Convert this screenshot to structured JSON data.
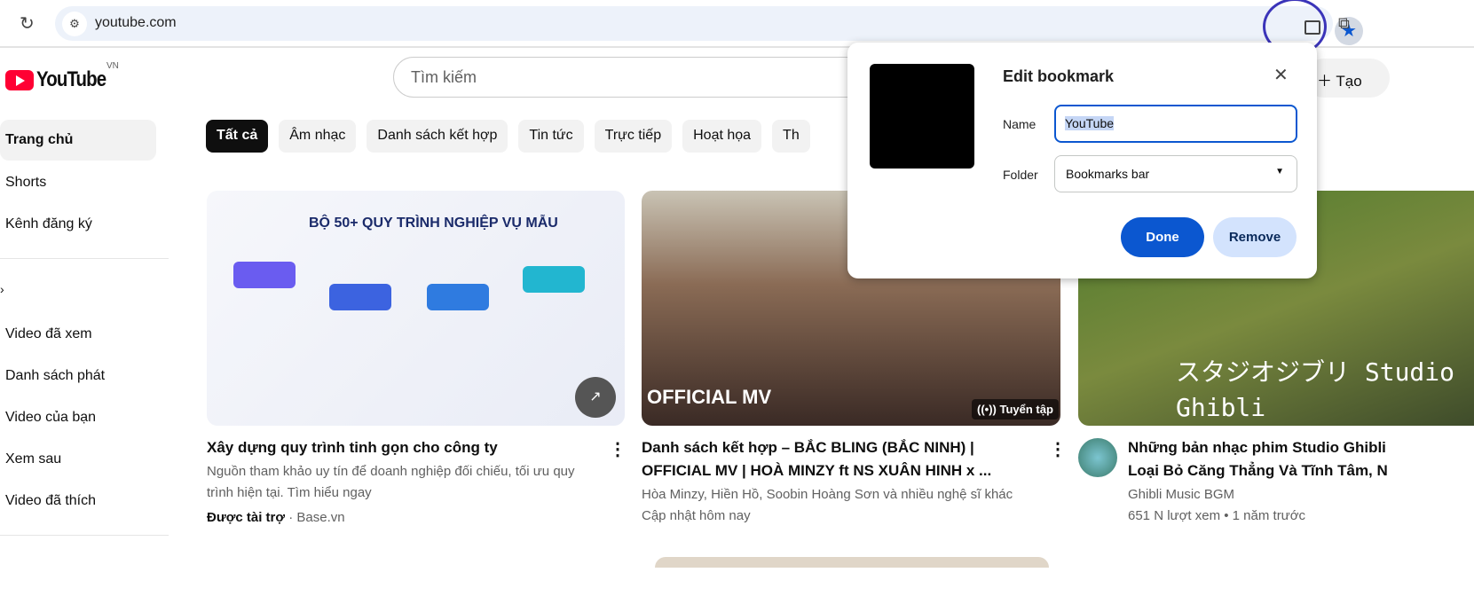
{
  "browser": {
    "url": "youtube.com",
    "icons": [
      "reload-icon",
      "site-settings-icon",
      "cast-icon",
      "bookmark-star-icon",
      "extensions-icon"
    ],
    "accent": "#0b57d0"
  },
  "youtube": {
    "logo": "YouTube",
    "region": "VN",
    "search_placeholder": "Tìm kiếm",
    "create_label": "Tạo",
    "sidebar": [
      {
        "label": "Trang chủ"
      },
      {
        "label": "Shorts"
      },
      {
        "label": "Kênh đăng ký"
      },
      {
        "label": "Video đã xem"
      },
      {
        "label": "Danh sách phát"
      },
      {
        "label": "Video của bạn"
      },
      {
        "label": "Xem sau"
      },
      {
        "label": "Video đã thích"
      }
    ],
    "chips": [
      "Tất cả",
      "Âm nhạc",
      "Danh sách kết hợp",
      "Tin tức",
      "Trực tiếp",
      "Hoạt họa",
      "Th"
    ],
    "videos": [
      {
        "title": "Xây dựng quy trình tinh gọn cho công ty",
        "desc": "Nguồn tham khảo uy tín để doanh nghiệp đối chiếu, tối ưu quy trình hiện tại. Tìm hiểu ngay",
        "sponsored": "Được tài trợ",
        "channel": "Base.vn",
        "thumb_text": "BỘ 50+ QUY TRÌNH NGHIỆP VỤ MẪU"
      },
      {
        "title": "Danh sách kết hợp – BẮC BLING (BẮC NINH) | OFFICIAL MV | HOÀ MINZY ft NS XUÂN HINH x ...",
        "channel": "Hòa Minzy, Hiền Hồ, Soobin Hoàng Sơn và nhiều nghệ sĩ khác",
        "meta": "Cập nhật hôm nay",
        "badge": "Tuyển tập",
        "thumb_text": "OFFICIAL MV"
      },
      {
        "title": "Những bản nhạc phim Studio Ghibli Loại Bỏ Căng Thẳng Và Tĩnh Tâm, N",
        "channel": "Ghibli Music BGM",
        "meta": "651 N lượt xem • 1 năm trước",
        "thumb_text": "スタジオジブリ Studio Ghibli"
      }
    ]
  },
  "dialog": {
    "title": "Edit bookmark",
    "name_label": "Name",
    "name_value": "YouTube",
    "folder_label": "Folder",
    "folder_value": "Bookmarks bar",
    "done": "Done",
    "remove": "Remove"
  }
}
